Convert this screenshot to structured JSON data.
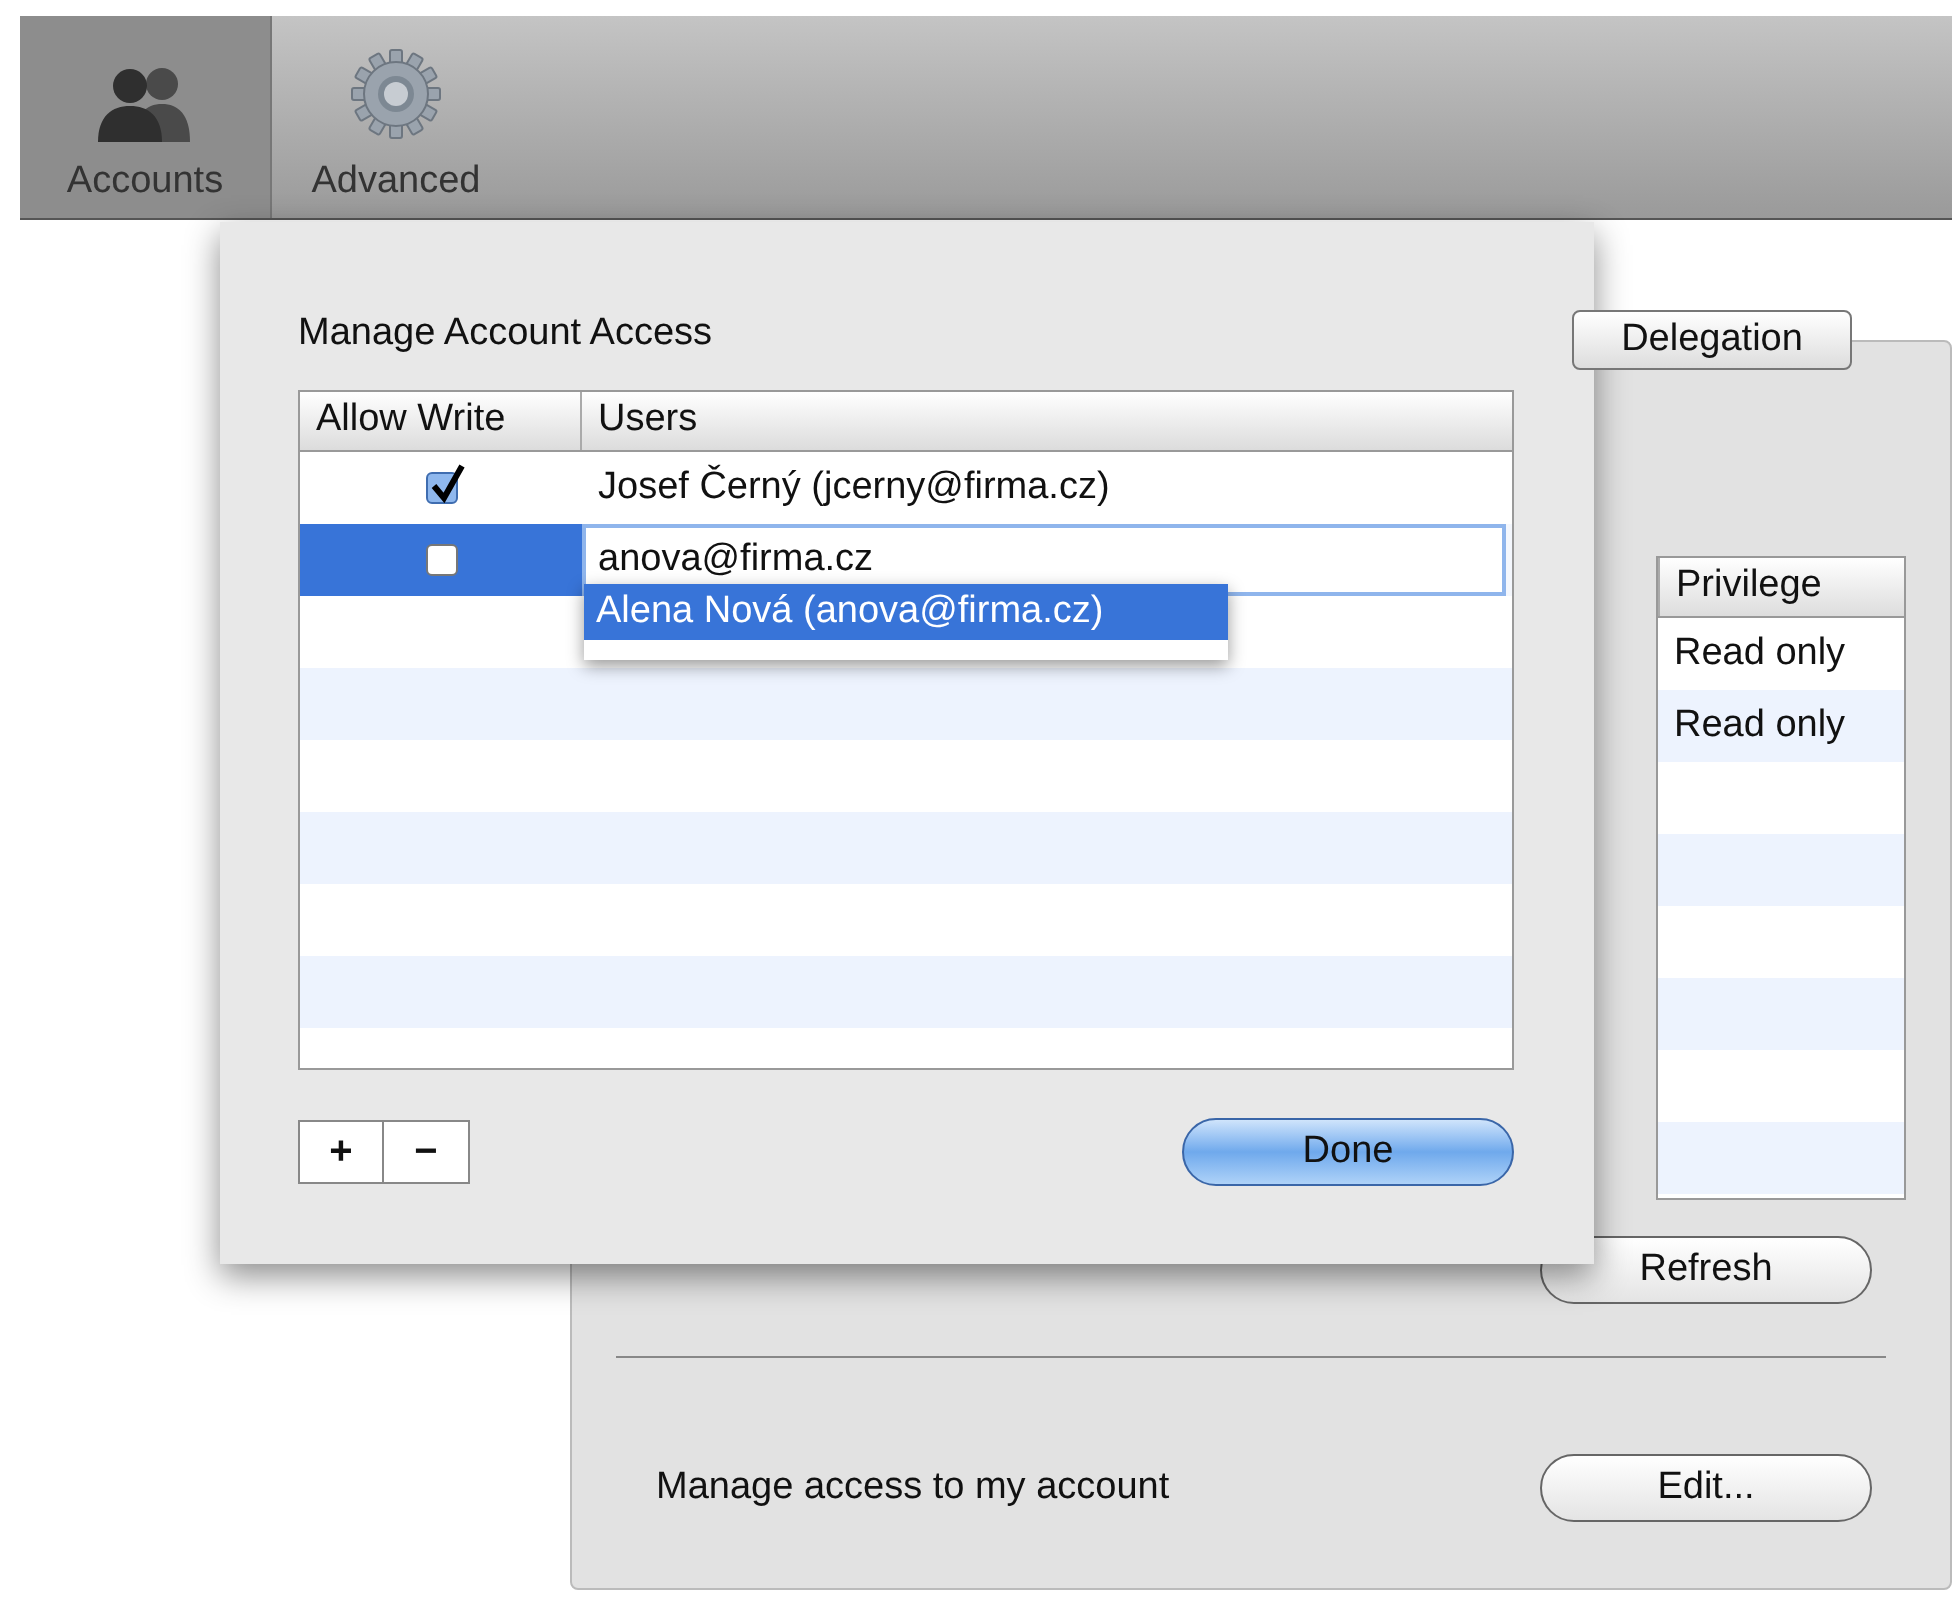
{
  "toolbar": {
    "items": [
      {
        "label": "Accounts",
        "kind": "people",
        "selected": true
      },
      {
        "label": "Advanced",
        "kind": "gear",
        "selected": false
      }
    ]
  },
  "main": {
    "tabs": [
      {
        "label": "Delegation",
        "selected": true
      }
    ],
    "table": {
      "columns": [
        "Privilege"
      ],
      "rows": [
        {
          "privilege": "Read only"
        },
        {
          "privilege": "Read only"
        }
      ]
    },
    "refresh_button": "Refresh",
    "access_label": "Manage access to my account",
    "edit_button": "Edit..."
  },
  "sheet": {
    "title": "Manage Account Access",
    "columns": [
      "Allow Write",
      "Users"
    ],
    "rows": [
      {
        "checked": true,
        "user": "Josef Černý (jcerny@firma.cz)",
        "selected": false,
        "kind": "text"
      },
      {
        "checked": false,
        "user": "anova@firma.cz",
        "selected": true,
        "kind": "editing"
      }
    ],
    "suggestions": [
      {
        "label": "Alena Nová (anova@firma.cz)",
        "selected": true
      }
    ],
    "add_button": "+",
    "remove_button": "−",
    "done_button": "Done"
  }
}
